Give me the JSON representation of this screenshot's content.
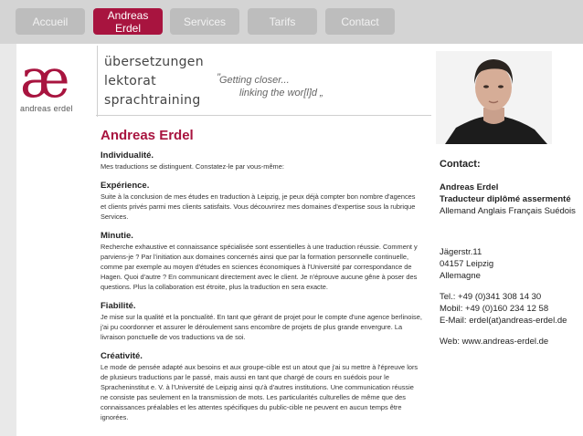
{
  "nav": {
    "tabs": [
      {
        "label": "Accueil"
      },
      {
        "label": "Andreas\nErdel"
      },
      {
        "label": "Services"
      },
      {
        "label": "Tarifs"
      },
      {
        "label": "Contact"
      }
    ],
    "active_index": 1
  },
  "logo": {
    "mark": "æ",
    "name": "andreas erdel"
  },
  "services": [
    "übersetzungen",
    "lektorat",
    "sprachtraining"
  ],
  "slogan": {
    "open_quote": "”",
    "line1": "Getting closer...",
    "line2": "linking the wor[l]d „"
  },
  "main": {
    "title": "Andreas Erdel",
    "sections": [
      {
        "heading": "Individualité.",
        "text": "Mes traductions se distinguent. Constatez-le par vous-même:"
      },
      {
        "heading": "Expérience.",
        "text": "Suite à la conclusion de mes études en traduction à Leipzig, je peux déjà compter bon nombre d'agences et clients privés parmi mes clients satisfaits. Vous découvrirez mes domaines d'expertise sous la rubrique Services."
      },
      {
        "heading": "Minutie.",
        "text": "Recherche exhaustive et connaissance spécialisée sont essentielles à une traduction réussie. Comment y parviens-je ? Par l'initiation aux domaines concernés ainsi que par la formation personnelle continuelle, comme par exemple au moyen d'études en sciences économiques à l'Université par correspondance de Hagen. Quoi d'autre ? En communicant directement avec le client. Je n'éprouve aucune gêne à poser des questions. Plus la collaboration est étroite, plus la traduction en sera exacte."
      },
      {
        "heading": "Fiabilité.",
        "text": "Je mise sur la qualité et la ponctualité. En tant que gérant de projet pour le compte d'une agence berlinoise, j'ai pu coordonner et assurer le déroulement sans encombre de projets de plus grande envergure. La livraison ponctuelle de vos traductions va de soi."
      },
      {
        "heading": "Créativité.",
        "text": "Le mode de pensée adapté aux besoins et aux groupe-cible est un atout que j'ai su mettre à l'épreuve lors de plusieurs traductions par le passé, mais aussi en tant que chargé de cours en suédois pour le Spracheninstitut e. V. à l'Université de Leipzig ainsi qu'à d'autres institutions. Une communication réussie ne consiste pas seulement en la transmission de mots. Les particularités culturelles de même que des connaissances préalables et les attentes spécifiques du public-cible ne peuvent en aucun temps être ignorées."
      }
    ]
  },
  "contact": {
    "heading": "Contact:",
    "name": "Andreas Erdel",
    "role": "Traducteur diplômé assermenté",
    "languages": "Allemand Anglais Français Suédois",
    "street": "Jägerstr.11",
    "city": "04157 Leipzig",
    "country": "Allemagne",
    "tel": "Tel.: +49 (0)341 308 14 30",
    "mobile": "Mobil: +49 (0)160 234 12 58",
    "email": "E-Mail: erdel(at)andreas-erdel.de",
    "web": "Web: www.andreas-erdel.de"
  },
  "colors": {
    "accent": "#a8143f",
    "tab": "#bdbdbd",
    "navbar": "#d4d4d4"
  }
}
